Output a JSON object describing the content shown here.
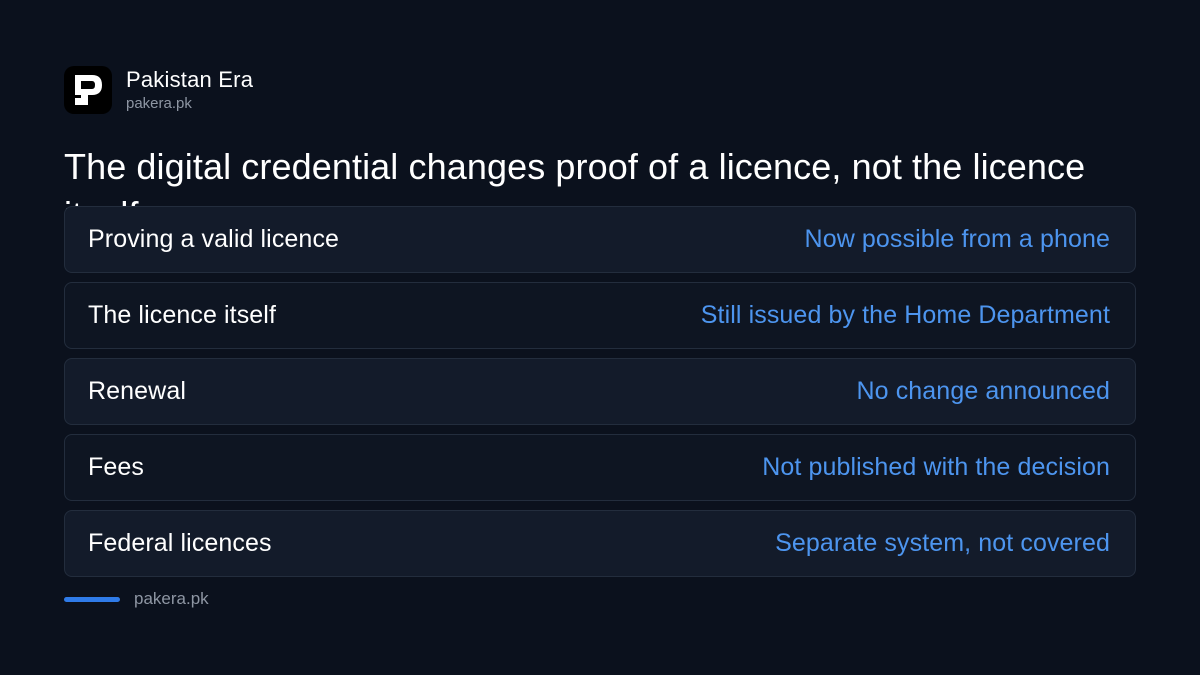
{
  "brand": {
    "name": "Pakistan Era",
    "url": "pakera.pk",
    "logo_icon": "pakistan-era-logo-icon"
  },
  "headline": "The digital credential changes proof of a licence, not the licence itself",
  "rows": [
    {
      "label": "Proving a valid licence",
      "value": "Now possible from a phone"
    },
    {
      "label": "The licence itself",
      "value": "Still issued by the Home Department"
    },
    {
      "label": "Renewal",
      "value": "No change announced"
    },
    {
      "label": "Fees",
      "value": "Not published with the decision"
    },
    {
      "label": "Federal licences",
      "value": "Separate system, not covered"
    }
  ],
  "footer": {
    "url": "pakera.pk"
  },
  "colors": {
    "background": "#0b111d",
    "accent": "#2f7be8",
    "value_text": "#4d95ef"
  }
}
